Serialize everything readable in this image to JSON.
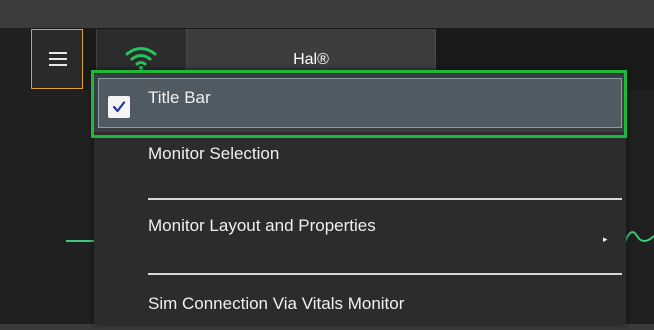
{
  "header": {
    "tab_label": "Hal®",
    "menu_icon": "hamburger-menu-icon",
    "connection_icon": "wifi-icon"
  },
  "dropdown": {
    "items": [
      {
        "label": "Title Bar",
        "checked": true,
        "highlighted": true
      },
      {
        "label": "Monitor Selection"
      },
      {
        "label": "Monitor Layout and Properties",
        "has_submenu": true
      },
      {
        "label": "Sim Connection Via Vitals Monitor"
      }
    ]
  },
  "colors": {
    "accent_orange": "#e0a030",
    "highlight_green": "#1fb83a",
    "wifi_green": "#22c55e",
    "waveform_green": "#3fc97a",
    "checkmark_blue": "#1a3aa8"
  }
}
